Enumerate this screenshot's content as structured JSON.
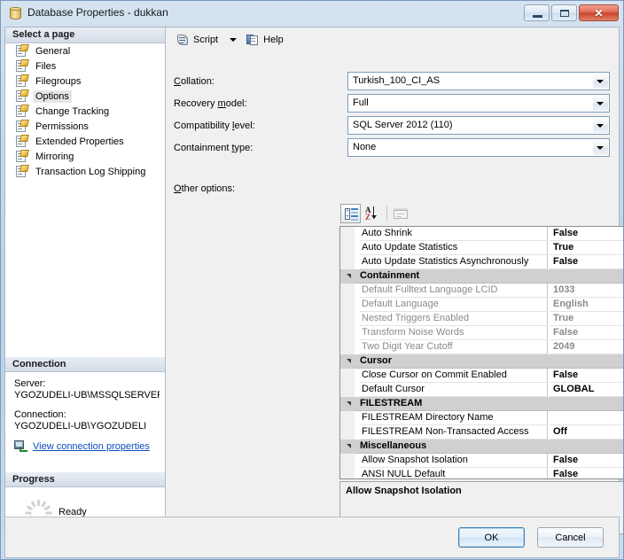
{
  "window": {
    "title": "Database Properties - dukkan",
    "icon": "database-icon",
    "minimize_label": "Minimize",
    "maximize_label": "Maximize",
    "close_label": "✕"
  },
  "sidebar": {
    "select_page_header": "Select a page",
    "pages": [
      {
        "label": "General",
        "selected": false
      },
      {
        "label": "Files",
        "selected": false
      },
      {
        "label": "Filegroups",
        "selected": false
      },
      {
        "label": "Options",
        "selected": true
      },
      {
        "label": "Change Tracking",
        "selected": false
      },
      {
        "label": "Permissions",
        "selected": false
      },
      {
        "label": "Extended Properties",
        "selected": false
      },
      {
        "label": "Mirroring",
        "selected": false
      },
      {
        "label": "Transaction Log Shipping",
        "selected": false
      }
    ],
    "connection": {
      "header": "Connection",
      "server_label": "Server:",
      "server_value": "YGOZUDELI-UB\\MSSQLSERVER",
      "connection_label": "Connection:",
      "connection_value": "YGOZUDELI-UB\\YGOZUDELI",
      "view_properties_link": "View connection properties"
    },
    "progress": {
      "header": "Progress",
      "status": "Ready"
    }
  },
  "toolbar": {
    "script_label": "Script",
    "help_label": "Help"
  },
  "form": {
    "rows": [
      {
        "label_pre": "",
        "label_accel": "C",
        "label_post": "ollation:",
        "value": "Turkish_100_CI_AS",
        "readonly": false
      },
      {
        "label_pre": "Recovery ",
        "label_accel": "m",
        "label_post": "odel:",
        "value": "Full",
        "readonly": false
      },
      {
        "label_pre": "Compatibility ",
        "label_accel": "l",
        "label_post": "evel:",
        "value": "SQL Server 2012 (110)",
        "readonly": false
      },
      {
        "label_pre": "Containment ",
        "label_accel": "t",
        "label_post": "ype:",
        "value": "None",
        "readonly": false
      }
    ],
    "other_options_pre": "",
    "other_options_accel": "O",
    "other_options_post": "ther options:"
  },
  "grid_toolbar": {
    "categorized": "categorized-view-icon",
    "alphabetical": "alphabetical-sort-icon",
    "property_pages": "property-pages-icon"
  },
  "property_grid": {
    "rows": [
      {
        "type": "property",
        "name": "Auto Shrink",
        "value": "False",
        "disabled": false
      },
      {
        "type": "property",
        "name": "Auto Update Statistics",
        "value": "True",
        "disabled": false
      },
      {
        "type": "property",
        "name": "Auto Update Statistics Asynchronously",
        "value": "False",
        "disabled": false
      },
      {
        "type": "category",
        "name": "Containment"
      },
      {
        "type": "property",
        "name": "Default Fulltext Language LCID",
        "value": "1033",
        "disabled": true
      },
      {
        "type": "property",
        "name": "Default Language",
        "value": "English",
        "disabled": true
      },
      {
        "type": "property",
        "name": "Nested Triggers Enabled",
        "value": "True",
        "disabled": true
      },
      {
        "type": "property",
        "name": "Transform Noise Words",
        "value": "False",
        "disabled": true
      },
      {
        "type": "property",
        "name": "Two Digit Year Cutoff",
        "value": "2049",
        "disabled": true
      },
      {
        "type": "category",
        "name": "Cursor"
      },
      {
        "type": "property",
        "name": "Close Cursor on Commit Enabled",
        "value": "False",
        "disabled": false
      },
      {
        "type": "property",
        "name": "Default Cursor",
        "value": "GLOBAL",
        "disabled": false
      },
      {
        "type": "category",
        "name": "FILESTREAM"
      },
      {
        "type": "property",
        "name": "FILESTREAM Directory Name",
        "value": "",
        "disabled": false
      },
      {
        "type": "property",
        "name": "FILESTREAM Non-Transacted Access",
        "value": "Off",
        "disabled": false
      },
      {
        "type": "category",
        "name": "Miscellaneous"
      },
      {
        "type": "property",
        "name": "Allow Snapshot Isolation",
        "value": "False",
        "disabled": false
      },
      {
        "type": "property",
        "name": "ANSI NULL Default",
        "value": "False",
        "disabled": false
      }
    ]
  },
  "description": {
    "title": "Allow Snapshot Isolation"
  },
  "footer": {
    "ok_label": "OK",
    "cancel_label": "Cancel"
  },
  "colors": {
    "accent": "#3c7fb1",
    "link": "#0b4fbb",
    "category_bg": "#d0d0d0",
    "close_button": "#c8442e"
  }
}
